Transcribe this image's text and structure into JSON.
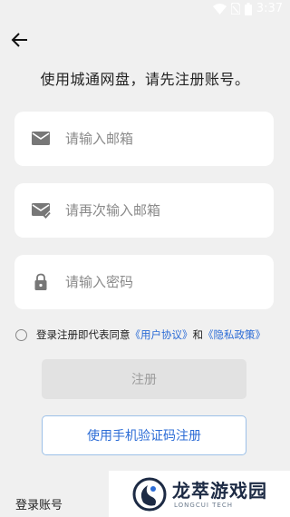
{
  "status_bar": {
    "time": "3:37"
  },
  "header": {
    "title": "使用城通网盘，请先注册账号。"
  },
  "form": {
    "email_placeholder": "请输入邮箱",
    "email_confirm_placeholder": "请再次输入邮箱",
    "password_placeholder": "请输入密码"
  },
  "agreement": {
    "prefix": "登录注册即代表同意",
    "user_agreement": "《用户协议》",
    "and": "和",
    "privacy_policy": "《隐私政策》"
  },
  "buttons": {
    "register": "注册",
    "sms_register": "使用手机验证码注册"
  },
  "footer": {
    "login_link": "登录账号"
  },
  "watermark": {
    "brand": "龙萃游戏园",
    "brand_en": "LONGCUI TECH"
  },
  "colors": {
    "background": "#f0f0f0",
    "link": "#2c6cd6",
    "disabled_button": "#e2e2e2"
  }
}
